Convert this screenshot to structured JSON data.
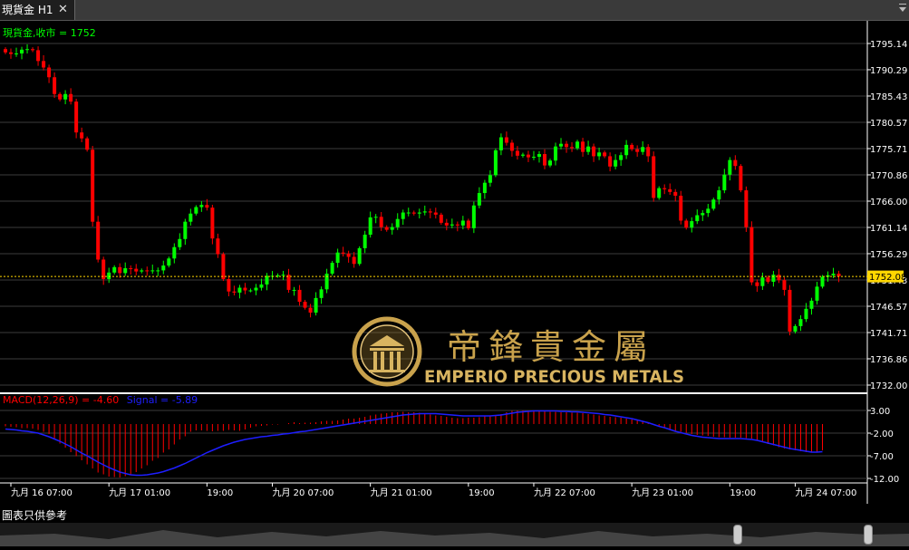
{
  "tab": {
    "title": "現貨金 H1",
    "close": "✕"
  },
  "price_label": "現貨金,收市 = 1752",
  "current_price": "1752.08",
  "macd": {
    "label": "MACD(12,26,9) = -4.60",
    "signal_label": "Signal = -5.89"
  },
  "disclaimer": "圖表只供參考",
  "logo": {
    "chinese": "帝鋒貴金屬",
    "english": "EMPERIO PRECIOUS METALS"
  },
  "colors": {
    "up": "#00ff00",
    "down": "#ff0000",
    "price_line": "#ffd700",
    "signal": "#1e1eff",
    "grid": "#3c3c3c",
    "axis_text": "#ffffff"
  },
  "chart_data": {
    "type": "candlestick",
    "y_ticks": [
      "1795.14",
      "1790.29",
      "1785.43",
      "1780.57",
      "1775.71",
      "1770.86",
      "1766.00",
      "1761.14",
      "1756.29",
      "1751.43",
      "1746.57",
      "1741.71",
      "1736.86",
      "1732.00"
    ],
    "ylim": [
      1732.0,
      1795.14
    ],
    "x_labels": [
      "九月 16 07:00",
      "九月 17 01:00",
      "19:00",
      "九月 20 07:00",
      "九月 21 01:00",
      "19:00",
      "九月 22 07:00",
      "九月 23 01:00",
      "19:00",
      "九月 24 07:00"
    ],
    "close": [
      1793.5,
      1793.2,
      1793.3,
      1794.0,
      1794.1,
      1793.9,
      1791.9,
      1790.7,
      1788.9,
      1785.8,
      1784.8,
      1785.8,
      1784.4,
      1778.7,
      1777.6,
      1775.5,
      1762.2,
      1755.2,
      1751.6,
      1752.8,
      1753.8,
      1752.7,
      1753.6,
      1753.5,
      1753.0,
      1753.2,
      1753.1,
      1753.2,
      1753.2,
      1754.1,
      1755.4,
      1757.5,
      1759.0,
      1762.2,
      1763.7,
      1764.9,
      1765.3,
      1764.8,
      1759.1,
      1756.2,
      1751.6,
      1749.3,
      1749.1,
      1750.0,
      1749.5,
      1749.5,
      1750.0,
      1750.6,
      1752.2,
      1752.2,
      1752.3,
      1752.4,
      1749.6,
      1749.6,
      1747.4,
      1746.3,
      1745.4,
      1748.1,
      1749.7,
      1752.6,
      1754.6,
      1756.5,
      1756.3,
      1755.7,
      1754.4,
      1757.3,
      1759.8,
      1763.0,
      1763.1,
      1761.2,
      1760.7,
      1761.2,
      1762.7,
      1763.9,
      1763.9,
      1763.7,
      1763.9,
      1764.1,
      1763.9,
      1763.5,
      1762.0,
      1761.5,
      1761.7,
      1761.5,
      1762.4,
      1761.0,
      1765.2,
      1767.5,
      1769.4,
      1770.8,
      1775.4,
      1777.8,
      1776.8,
      1775.3,
      1774.4,
      1774.6,
      1774.1,
      1774.2,
      1774.7,
      1772.6,
      1773.5,
      1776.1,
      1776.6,
      1776.0,
      1775.8,
      1777.0,
      1775.1,
      1776.1,
      1774.3,
      1775.0,
      1774.3,
      1772.4,
      1773.6,
      1774.5,
      1776.4,
      1775.6,
      1775.1,
      1776.0,
      1774.3,
      1766.6,
      1768.4,
      1768.2,
      1767.7,
      1767.0,
      1762.4,
      1761.1,
      1762.3,
      1763.4,
      1763.8,
      1764.6,
      1766.3,
      1768.0,
      1770.9,
      1773.6,
      1772.5,
      1768.0,
      1761.2,
      1751.0,
      1750.3,
      1751.9,
      1751.1,
      1752.4,
      1751.4,
      1749.6,
      1741.9,
      1742.9,
      1744.2,
      1746.1,
      1747.6,
      1750.2,
      1752.0,
      1752.3,
      1752.6,
      1752.1
    ]
  },
  "macd_data": {
    "ylim": [
      -12.0,
      3.0
    ],
    "y_ticks": [
      "3.00",
      "-2.00",
      "-7.00",
      "-12.00"
    ],
    "hist": [
      -0.5,
      -0.6,
      -0.7,
      -0.9,
      -0.9,
      -1.0,
      -1.3,
      -1.7,
      -2.2,
      -3.3,
      -4.3,
      -5.2,
      -6.2,
      -7.1,
      -8.0,
      -8.9,
      -9.8,
      -10.7,
      -11.1,
      -11.6,
      -11.7,
      -11.8,
      -11.5,
      -11.2,
      -10.6,
      -9.8,
      -9.1,
      -8.1,
      -7.5,
      -6.3,
      -5.6,
      -4.5,
      -3.4,
      -2.7,
      -1.7,
      -1.4,
      -1.4,
      -1.5,
      -1.6,
      -1.5,
      -1.5,
      -1.3,
      -1.4,
      -1.5,
      -1.2,
      -0.8,
      -0.5,
      -0.4,
      -0.3,
      -0.1,
      -0.1,
      0.0,
      0.2,
      0.4,
      0.2,
      0.3,
      0.3,
      0.4,
      0.6,
      0.7,
      0.7,
      0.8,
      1.0,
      1.2,
      1.2,
      1.4,
      1.6,
      1.9,
      2.1,
      2.3,
      2.4,
      2.6,
      2.6,
      2.7,
      2.6,
      2.6,
      2.5,
      2.3,
      2.1,
      1.9,
      1.8,
      1.6,
      1.4,
      1.3,
      1.3,
      1.4,
      1.4,
      1.5,
      1.7,
      1.7,
      1.9,
      2.2,
      2.6,
      2.9,
      3.0,
      3.0,
      3.0,
      3.0,
      2.8,
      2.8,
      2.7,
      2.7,
      2.6,
      2.6,
      2.5,
      2.5,
      2.4,
      2.2,
      2.1,
      1.9,
      1.8,
      1.6,
      1.5,
      1.4,
      1.2,
      1.0,
      0.8,
      0.6,
      0.4,
      0.0,
      -0.5,
      -0.7,
      -1.1,
      -1.5,
      -1.7,
      -1.9,
      -2.2,
      -2.4,
      -2.5,
      -2.6,
      -2.8,
      -2.9,
      -2.9,
      -3.0,
      -3.0,
      -3.0,
      -3.1,
      -3.2,
      -3.5,
      -3.9,
      -4.4,
      -4.7,
      -5.1,
      -5.4,
      -5.6,
      -5.8,
      -6.0,
      -6.2,
      -6.3,
      -6.1,
      -5.8
    ],
    "signal": [
      -1.1,
      -1.2,
      -1.3,
      -1.5,
      -1.6,
      -1.8,
      -2.0,
      -2.4,
      -2.8,
      -3.3,
      -3.8,
      -4.4,
      -5.0,
      -5.7,
      -6.4,
      -7.0,
      -7.7,
      -8.4,
      -9.0,
      -9.6,
      -10.1,
      -10.6,
      -10.9,
      -11.2,
      -11.3,
      -11.3,
      -11.2,
      -11.0,
      -10.8,
      -10.5,
      -10.1,
      -9.7,
      -9.2,
      -8.7,
      -8.1,
      -7.5,
      -6.9,
      -6.3,
      -5.8,
      -5.3,
      -4.8,
      -4.4,
      -4.0,
      -3.7,
      -3.4,
      -3.2,
      -3.0,
      -2.8,
      -2.7,
      -2.5,
      -2.4,
      -2.2,
      -2.1,
      -1.9,
      -1.7,
      -1.6,
      -1.4,
      -1.2,
      -1.0,
      -0.8,
      -0.6,
      -0.4,
      -0.2,
      0.0,
      0.2,
      0.4,
      0.6,
      0.8,
      1.0,
      1.2,
      1.4,
      1.6,
      1.8,
      2.0,
      2.1,
      2.2,
      2.3,
      2.3,
      2.3,
      2.3,
      2.2,
      2.1,
      2.0,
      1.9,
      1.8,
      1.8,
      1.8,
      1.8,
      1.8,
      1.8,
      1.9,
      2.0,
      2.2,
      2.4,
      2.6,
      2.7,
      2.8,
      2.9,
      2.9,
      2.9,
      2.9,
      2.9,
      2.8,
      2.8,
      2.7,
      2.7,
      2.6,
      2.5,
      2.4,
      2.3,
      2.1,
      2.0,
      1.8,
      1.6,
      1.4,
      1.2,
      0.9,
      0.6,
      0.3,
      -0.1,
      -0.5,
      -0.8,
      -1.2,
      -1.6,
      -1.9,
      -2.2,
      -2.5,
      -2.7,
      -2.9,
      -3.0,
      -3.1,
      -3.2,
      -3.2,
      -3.2,
      -3.2,
      -3.2,
      -3.3,
      -3.4,
      -3.6,
      -3.9,
      -4.2,
      -4.5,
      -4.8,
      -5.1,
      -5.4,
      -5.6,
      -5.8,
      -6.0,
      -6.2,
      -6.2,
      -6.1
    ]
  }
}
